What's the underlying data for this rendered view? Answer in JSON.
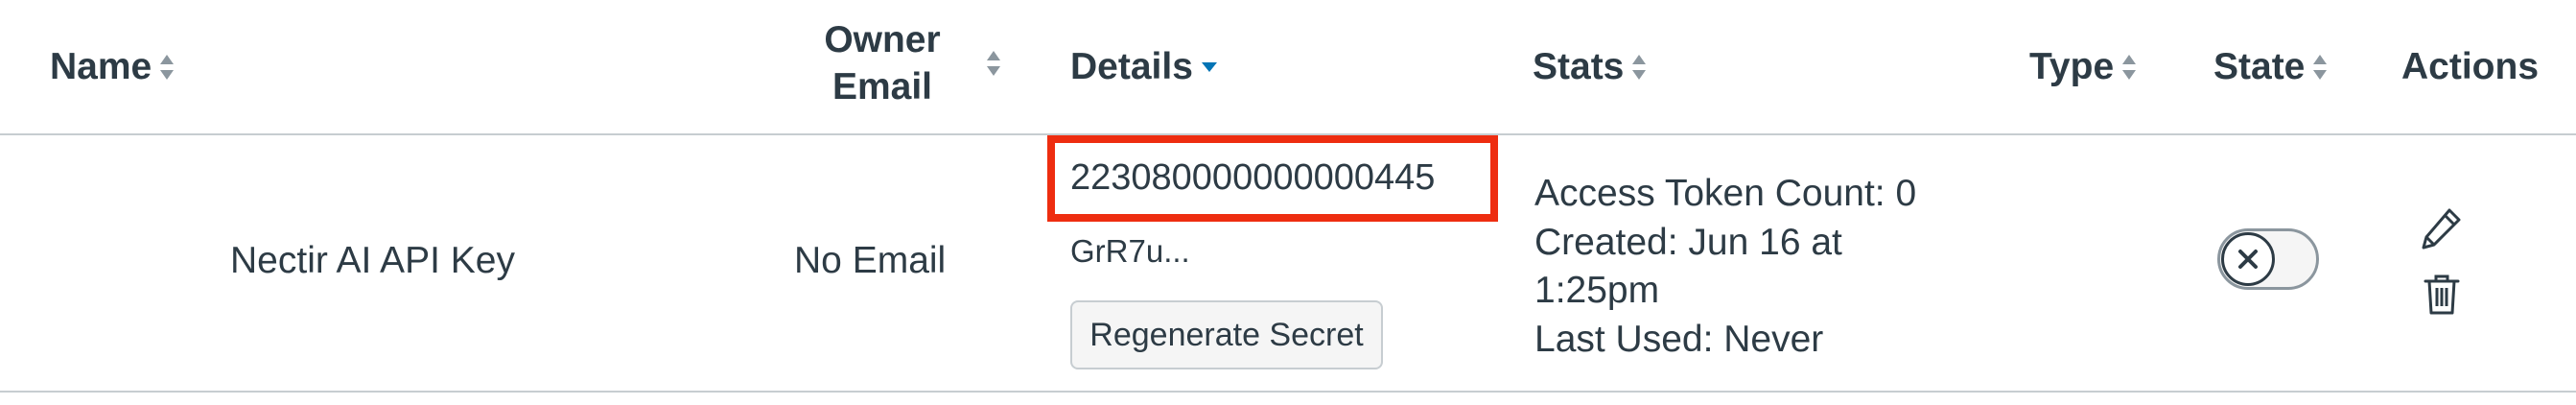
{
  "table": {
    "headers": {
      "name": "Name",
      "owner_email": "Owner Email",
      "owner_email_line1": "Owner",
      "owner_email_line2": "Email",
      "details": "Details",
      "stats": "Stats",
      "type": "Type",
      "state": "State",
      "actions": "Actions"
    },
    "rows": [
      {
        "name": "Nectir AI API Key",
        "owner_email": "No Email",
        "details_id": "223080000000000445",
        "details_secret": "GrR7u...",
        "regenerate_label": "Regenerate Secret",
        "stats": {
          "access_token_count": "Access Token Count: 0",
          "created_line1": "Created: Jun 16 at",
          "created_line2": "1:25pm",
          "last_used": "Last Used: Never"
        },
        "type": "",
        "state_toggle": "off"
      }
    ]
  },
  "colors": {
    "highlight": "#ee2d10",
    "sort_active": "#0374b5",
    "text": "#2d3b45"
  },
  "icons": {
    "sort": "sort-icon",
    "sort_desc": "sort-desc-icon",
    "toggle_off": "x-icon",
    "edit": "pencil-icon",
    "delete": "trash-icon"
  }
}
